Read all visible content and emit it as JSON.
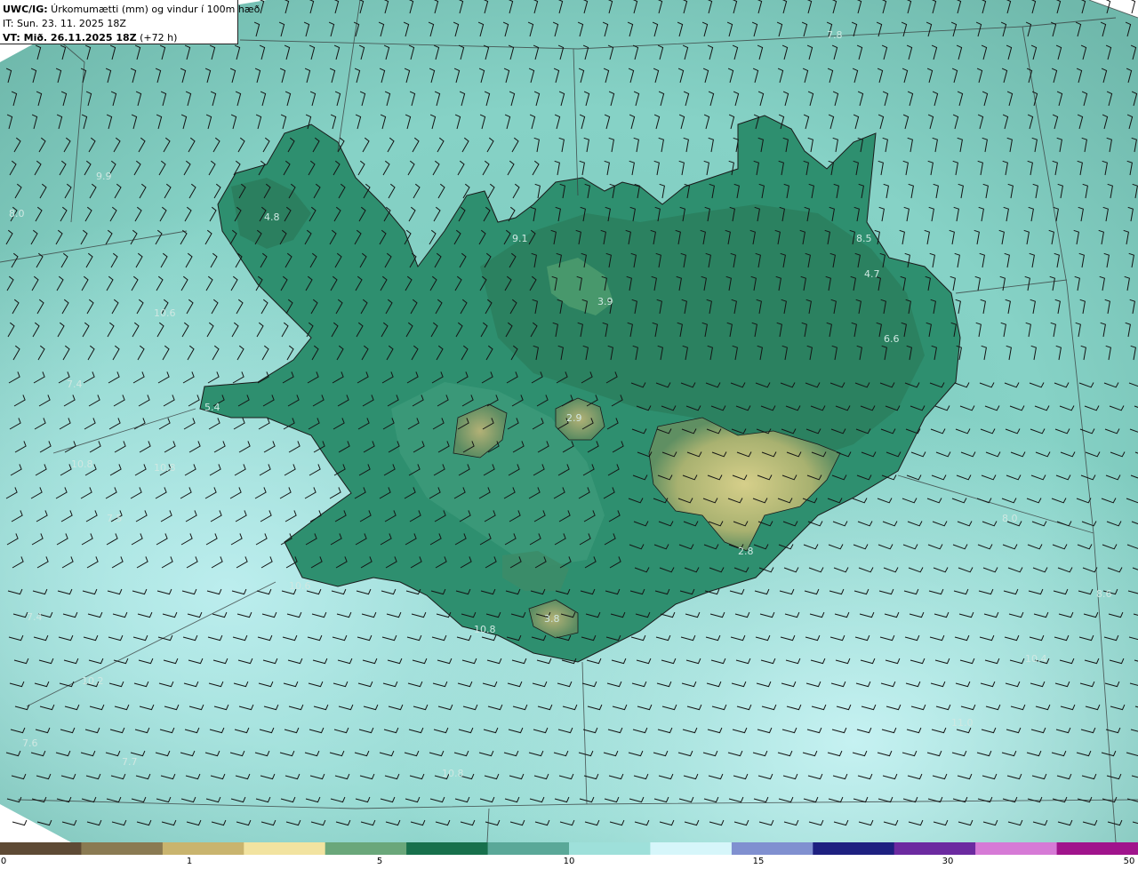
{
  "header": {
    "model": "UWC/IG:",
    "title": " Úrkomumætti (mm) og vindur í 100m hæð",
    "init": "IT: Sun. 23. 11. 2025 18Z",
    "valid_bold": "VT: Mið. 26.11.2025 18Z",
    "valid_lead": " (+72 h)"
  },
  "map_labels": [
    "7.8",
    "9.9",
    "8.0",
    "4.8",
    "9.1",
    "4.7",
    "3.9",
    "6.6",
    "10.6",
    "8.5",
    "7.4",
    "5.4",
    "2.9",
    "10.8",
    "10.8",
    "7.5",
    "8.0",
    "2.8",
    "10.6",
    "3.8",
    "8.6",
    "7.4",
    "10.8",
    "10.2",
    "10.4",
    "11.0",
    "7.6",
    "7.7",
    "10.8"
  ],
  "colorbar": {
    "ticks": [
      "0",
      "1",
      "5",
      "10",
      "15",
      "30",
      "50"
    ],
    "colors": [
      "#5e4a35",
      "#8a7a52",
      "#c9b46e",
      "#f2e3a0",
      "#6aa77a",
      "#17704c",
      "#5aa898",
      "#9ee0da",
      "#d6f6fa",
      "#8090d0",
      "#1e2080",
      "#6c2aa0",
      "#d67ad6",
      "#a0148c"
    ]
  }
}
